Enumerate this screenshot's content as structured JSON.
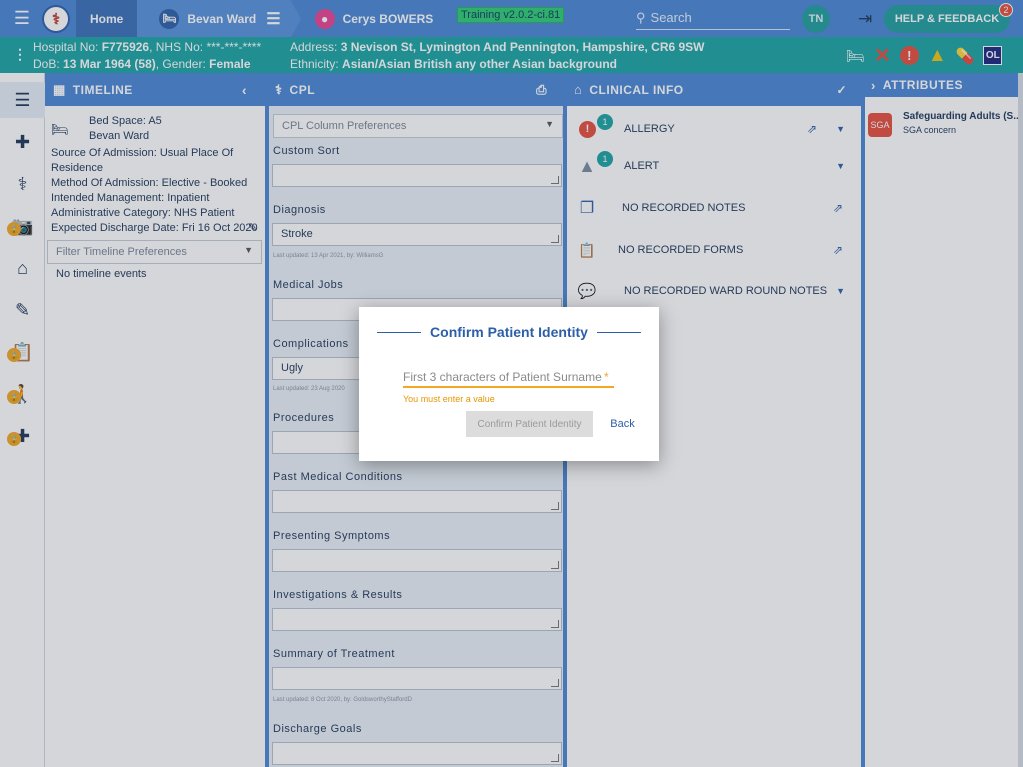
{
  "topbar": {
    "home_label": "Home",
    "ward_label": "Bevan Ward",
    "patient_name": "Cerys BOWERS",
    "training_label": "Training v2.0.2-ci.81",
    "search_placeholder": "Search",
    "user_initials": "TN",
    "help_label": "HELP & FEEDBACK",
    "help_count": "2"
  },
  "banner": {
    "hospital_no_label": "Hospital No:",
    "hospital_no": "F775926",
    "nhs_no_label": ", NHS No:",
    "nhs_no": "***-***-****",
    "dob_label": "DoB:",
    "dob": "13 Mar 1964 (58)",
    "gender_label": ", Gender:",
    "gender": "Female",
    "address_label": "Address:",
    "address": "3 Nevison St, Lymington And Pennington, Hampshire, CR6 9SW",
    "ethnicity_label": "Ethnicity:",
    "ethnicity": "Asian/Asian British any other Asian background",
    "ol_label": "OL"
  },
  "panels": {
    "timeline_title": "TIMELINE",
    "cpl_title": "CPL",
    "clinical_title": "CLINICAL INFO",
    "attributes_title": "ATTRIBUTES"
  },
  "timeline": {
    "bed_space": "Bed Space: A5",
    "ward": "Bevan Ward",
    "source_1": "Source Of Admission: Usual Place Of",
    "source_2": "Residence",
    "method": "Method Of Admission: Elective - Booked",
    "management": "Intended Management: Inpatient",
    "category": "Administrative Category: NHS Patient",
    "discharge": "Expected Discharge Date: Fri 16 Oct 2020",
    "filter_placeholder": "Filter Timeline Preferences",
    "no_events": "No timeline events"
  },
  "cpl": {
    "column_prefs": "CPL Column Preferences",
    "fields": [
      {
        "label": "Custom Sort",
        "value": "",
        "meta": ""
      },
      {
        "label": "Diagnosis",
        "value": "Stroke",
        "meta": "Last updated: 13 Apr 2021, by: WilliamsG"
      },
      {
        "label": "Medical Jobs",
        "value": "",
        "meta": ""
      },
      {
        "label": "Complications",
        "value": "Ugly",
        "meta": "Last updated: 23 Aug 2020"
      },
      {
        "label": "Procedures",
        "value": "",
        "meta": ""
      },
      {
        "label": "Past Medical Conditions",
        "value": "",
        "meta": ""
      },
      {
        "label": "Presenting Symptoms",
        "value": "",
        "meta": ""
      },
      {
        "label": "Investigations & Results",
        "value": "",
        "meta": ""
      },
      {
        "label": "Summary of Treatment",
        "value": "",
        "meta": "Last updated: 8 Oct 2020, by: GoldsworthyStaffordD"
      },
      {
        "label": "Discharge Goals",
        "value": "",
        "meta": ""
      }
    ]
  },
  "clinical": {
    "allergy": "ALLERGY",
    "allergy_count": "1",
    "alert": "ALERT",
    "alert_count": "1",
    "notes": "NO RECORDED NOTES",
    "forms": "NO RECORDED FORMS",
    "ward_round": "NO RECORDED WARD ROUND NOTES"
  },
  "attributes": {
    "logo_text": "SGA",
    "title": "Safeguarding Adults (S...",
    "subtitle": "SGA concern"
  },
  "modal": {
    "title": "Confirm Patient Identity",
    "input_placeholder": "First 3 characters of Patient Surname",
    "required_mark": "*",
    "error": "You must enter a value",
    "confirm_label": "Confirm Patient Identity",
    "back_label": "Back"
  }
}
